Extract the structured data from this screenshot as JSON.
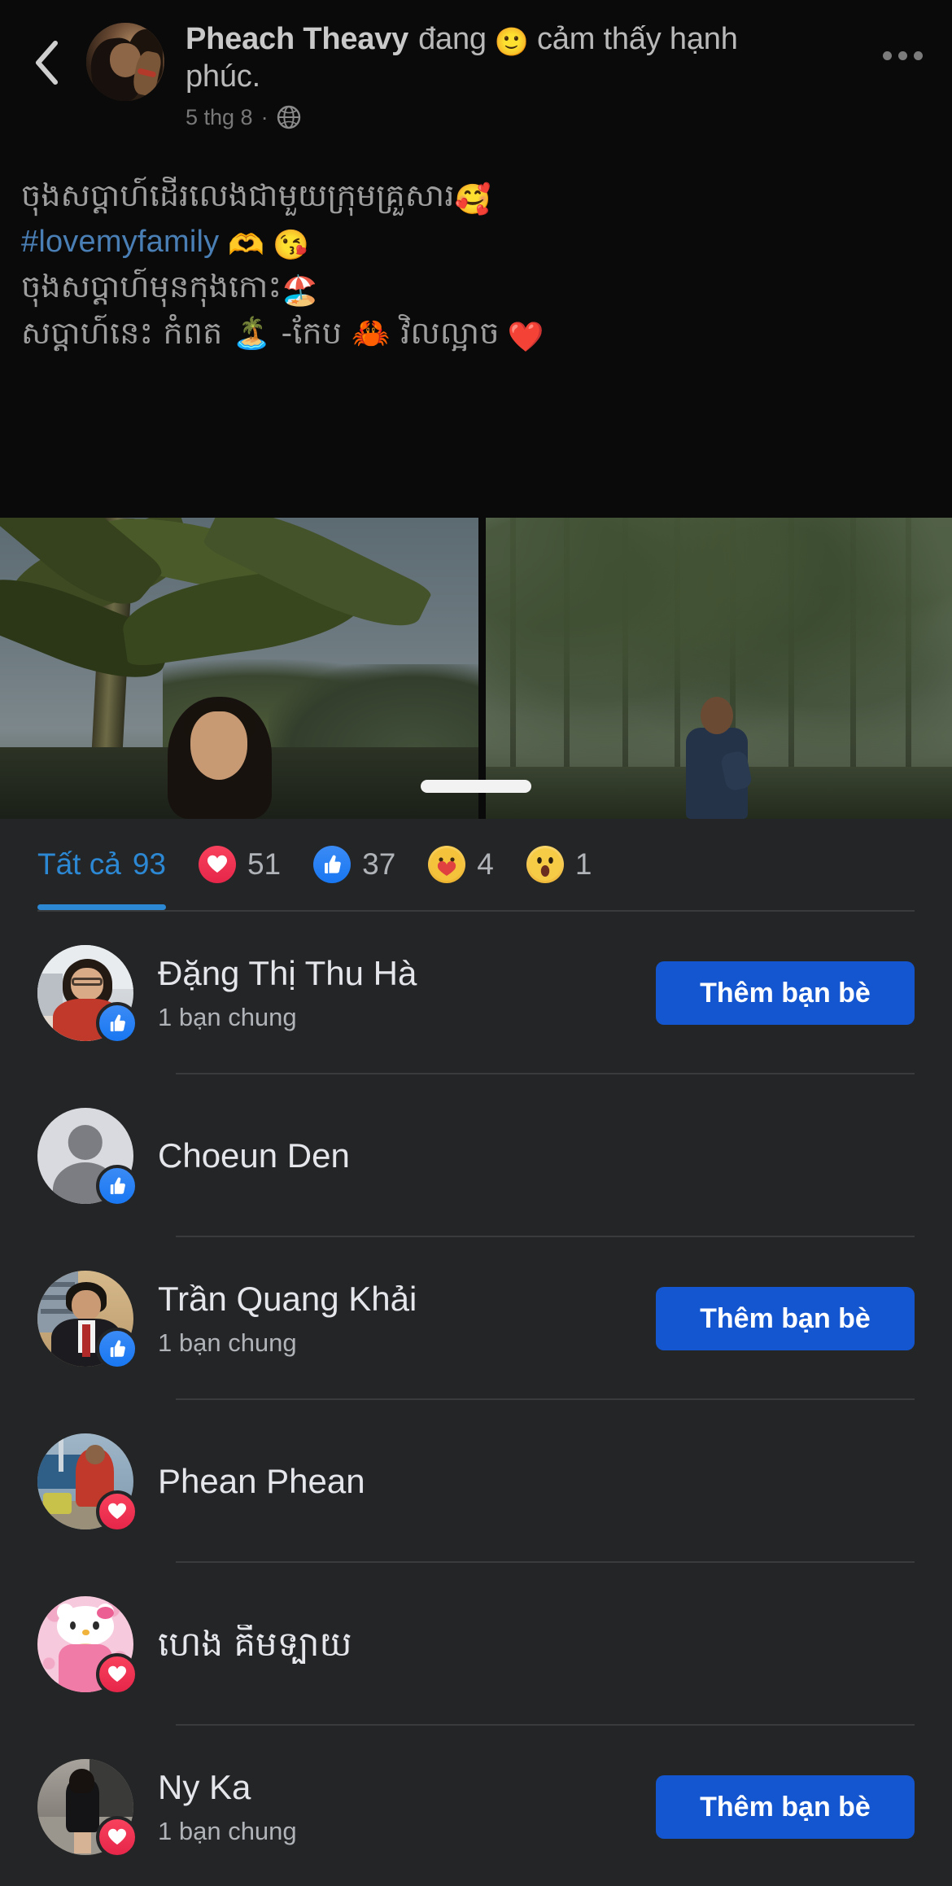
{
  "post": {
    "author_name": "Pheach Theavy",
    "feeling_prefix": "đang",
    "feeling_emoji": "🙂",
    "feeling_text": "cảm thấy hạnh phúc.",
    "timestamp": "5 thg 8",
    "meta_separator": "·",
    "privacy_icon": "globe-icon",
    "back_icon": "back-chevron-icon",
    "more_icon": "more-options-icon",
    "lines": [
      {
        "text": "ចុងសប្តាហ៍ដើរលេងជាមួយក្រុមគ្រួសារ",
        "emoji": "🥰",
        "type": "khmer"
      },
      {
        "text": "#lovemyfamily",
        "emoji": "🫶 😘",
        "type": "hashtag"
      },
      {
        "text": "ចុងសប្តាហ៍មុនកុងកោះ",
        "emoji": "🏖️",
        "type": "khmer"
      },
      {
        "text": "សប្តាហ៍នេះ កំពត 🏝️ -កែប 🦀 វិលល្អាច",
        "emoji": "❤️",
        "type": "khmer"
      }
    ]
  },
  "sheet": {
    "handle": "drag-handle",
    "tabs": [
      {
        "id": "all",
        "label": "Tất cả",
        "count": "93",
        "icon": null,
        "active": true
      },
      {
        "id": "love",
        "label": "",
        "count": "51",
        "icon": "love-reaction-icon",
        "active": false
      },
      {
        "id": "like",
        "label": "",
        "count": "37",
        "icon": "like-reaction-icon",
        "active": false
      },
      {
        "id": "care",
        "label": "",
        "count": "4",
        "icon": "care-reaction-icon",
        "active": false
      },
      {
        "id": "wow",
        "label": "",
        "count": "1",
        "icon": "wow-reaction-icon",
        "active": false
      }
    ],
    "add_friend_label": "Thêm bạn bè",
    "mutual_friends_label": "1 bạn chung",
    "people": [
      {
        "name": "Đặng Thị Thu Hà",
        "mutual": "1 bạn chung",
        "reaction": "like",
        "has_add_button": true,
        "avatar": "photo-woman-red",
        "name_script": "latin"
      },
      {
        "name": "Choeun Den",
        "mutual": "",
        "reaction": "like",
        "has_add_button": false,
        "avatar": "default-silhouette",
        "name_script": "latin"
      },
      {
        "name": "Trần Quang Khải",
        "mutual": "1 bạn chung",
        "reaction": "like",
        "has_add_button": true,
        "avatar": "photo-man-suit",
        "name_script": "latin"
      },
      {
        "name": "Phean Phean",
        "mutual": "",
        "reaction": "love",
        "has_add_button": false,
        "avatar": "photo-market",
        "name_script": "latin"
      },
      {
        "name": "ហេង គីមទ្បាយ",
        "mutual": "",
        "reaction": "love",
        "has_add_button": false,
        "avatar": "photo-hello-kitty",
        "name_script": "khmer"
      },
      {
        "name": "Ny Ka",
        "mutual": "1 bạn chung",
        "reaction": "love",
        "has_add_button": true,
        "avatar": "photo-woman-street",
        "name_script": "latin"
      }
    ]
  },
  "colors": {
    "sheet_bg": "#242526",
    "page_bg": "#0a0a0a",
    "accent_blue": "#2d88d4",
    "button_blue": "#1456cf",
    "text_primary": "#e4e6eb",
    "text_secondary": "#b0b3b8",
    "divider": "#3a3b3c",
    "love_red": "#e6264a",
    "like_blue": "#1877f2"
  }
}
